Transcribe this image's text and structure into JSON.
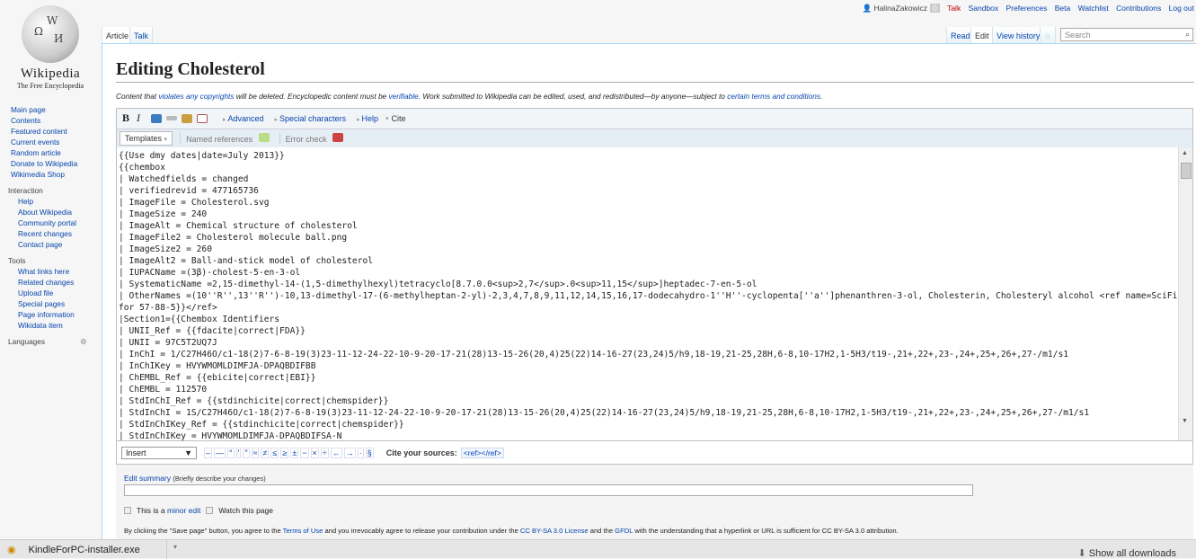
{
  "logo": {
    "wordmark": "Wikipedia",
    "tagline": "The Free Encyclopedia"
  },
  "sidebar": {
    "nav": [
      "Main page",
      "Contents",
      "Featured content",
      "Current events",
      "Random article",
      "Donate to Wikipedia",
      "Wikimedia Shop"
    ],
    "interaction_heading": "Interaction",
    "interaction": [
      "Help",
      "About Wikipedia",
      "Community portal",
      "Recent changes",
      "Contact page"
    ],
    "tools_heading": "Tools",
    "tools": [
      "What links here",
      "Related changes",
      "Upload file",
      "Special pages",
      "Page information",
      "Wikidata item"
    ],
    "languages_heading": "Languages"
  },
  "personal": {
    "user": "HalinaZakowicz",
    "notifications": "0",
    "talk": "Talk",
    "sandbox": "Sandbox",
    "preferences": "Preferences",
    "beta": "Beta",
    "watchlist": "Watchlist",
    "contributions": "Contributions",
    "logout": "Log out"
  },
  "tabs": {
    "article": "Article",
    "talk": "Talk",
    "read": "Read",
    "edit": "Edit",
    "history": "View history"
  },
  "search": {
    "placeholder": "Search"
  },
  "page": {
    "title": "Editing Cholesterol",
    "notice": {
      "t1": "Content that ",
      "l1": "violates any copyrights",
      "t2": " will be deleted. Encyclopedic content must be ",
      "l2": "verifiable",
      "t3": ". Work submitted to Wikipedia can be edited, used, and redistributed—by anyone—subject to ",
      "l3": "certain terms and conditions",
      "t4": "."
    }
  },
  "toolbar": {
    "bold": "B",
    "italic": "I",
    "advanced": "Advanced",
    "special": "Special characters",
    "help": "Help",
    "cite": "Cite",
    "templates": "Templates",
    "named_refs": "Named references",
    "error_check": "Error check"
  },
  "editor": {
    "lines": [
      "{{Use dmy dates|date=July 2013}}",
      "{{chembox",
      "| Watchedfields = changed",
      "| verifiedrevid = 477165736",
      "| ImageFile = Cholesterol.svg",
      "| ImageSize = 240",
      "| ImageAlt = Chemical structure of cholesterol",
      "| ImageFile2 = Cholesterol molecule ball.png",
      "| ImageSize2 = 260",
      "| ImageAlt2 = Ball-and-stick model of cholesterol",
      "| IUPACName =(3β)-cholest-5-en-3-ol",
      "| SystematicName =2,15-dimethyl-14-(1,5-dimethylhexyl)tetracyclo[8.7.0.0<sup>2,7</sup>.0<sup>11,15</sup>]heptadec-7-en-5-ol",
      "| OtherNames =(10''R'',13''R'')-10,13-dimethyl-17-(6-methylheptan-2-yl)-2,3,4,7,8,9,11,12,14,15,16,17-dodecahydro-1''H''-cyclopenta[''a'']phenanthren-3-ol, Cholesterin, Cholesteryl alcohol <ref name=SciFinder>{{cite web|title=Substance Data",
      "for 57-88-5}}</ref>",
      "|Section1={{Chembox Identifiers",
      "| UNII_Ref = {{fdacite|correct|FDA}}",
      "| UNII = 97C5T2UQ7J",
      "| InChI = 1/C27H46O/c1-18(2)7-6-8-19(3)23-11-12-24-22-10-9-20-17-21(28)13-15-26(20,4)25(22)14-16-27(23,24)5/h9,18-19,21-25,28H,6-8,10-17H2,1-5H3/t19-,21+,22+,23-,24+,25+,26+,27-/m1/s1",
      "| InChIKey = HVYWMOMLDIMFJA-DPAQBDIFBB",
      "| ChEMBL_Ref = {{ebicite|correct|EBI}}",
      "| ChEMBL = 112570",
      "| StdInChI_Ref = {{stdinchicite|correct|chemspider}}",
      "| StdInChI = 1S/C27H46O/c1-18(2)7-6-8-19(3)23-11-12-24-22-10-9-20-17-21(28)13-15-26(20,4)25(22)14-16-27(23,24)5/h9,18-19,21-25,28H,6-8,10-17H2,1-5H3/t19-,21+,22+,23-,24+,25+,26+,27-/m1/s1",
      "| StdInChIKey_Ref = {{stdinchicite|correct|chemspider}}",
      "| StdInChIKey = HVYWMOMLDIMFJA-DPAQBDIFSA-N"
    ]
  },
  "insert": {
    "select": "Insert",
    "chars": [
      "–",
      "—",
      "°",
      "′",
      "″",
      "≈",
      "≠",
      "≤",
      "≥",
      "±",
      "−",
      "×",
      "÷",
      "←",
      "→",
      "·",
      "§"
    ],
    "cite_label": "Cite your sources:",
    "ref": "<ref></ref>"
  },
  "summary": {
    "label": "Edit summary",
    "hint": "(Briefly describe your changes)",
    "value": "",
    "minor_pre": "This is a ",
    "minor_link": "minor edit",
    "watch": "Watch this page"
  },
  "agreement": {
    "t1": "By clicking the \"Save page\" button, you agree to the ",
    "l1": "Terms of Use",
    "t2": " and you irrevocably agree to release your contribution under the ",
    "l2": "CC BY-SA 3.0 License",
    "t3": " and the ",
    "l3": "GFDL",
    "t4": " with the understanding that a hyperlink or URL is sufficient for CC BY-SA 3.0 attribution."
  },
  "downloads": {
    "file": "KindleForPC-installer.exe",
    "show_all": "Show all downloads"
  }
}
